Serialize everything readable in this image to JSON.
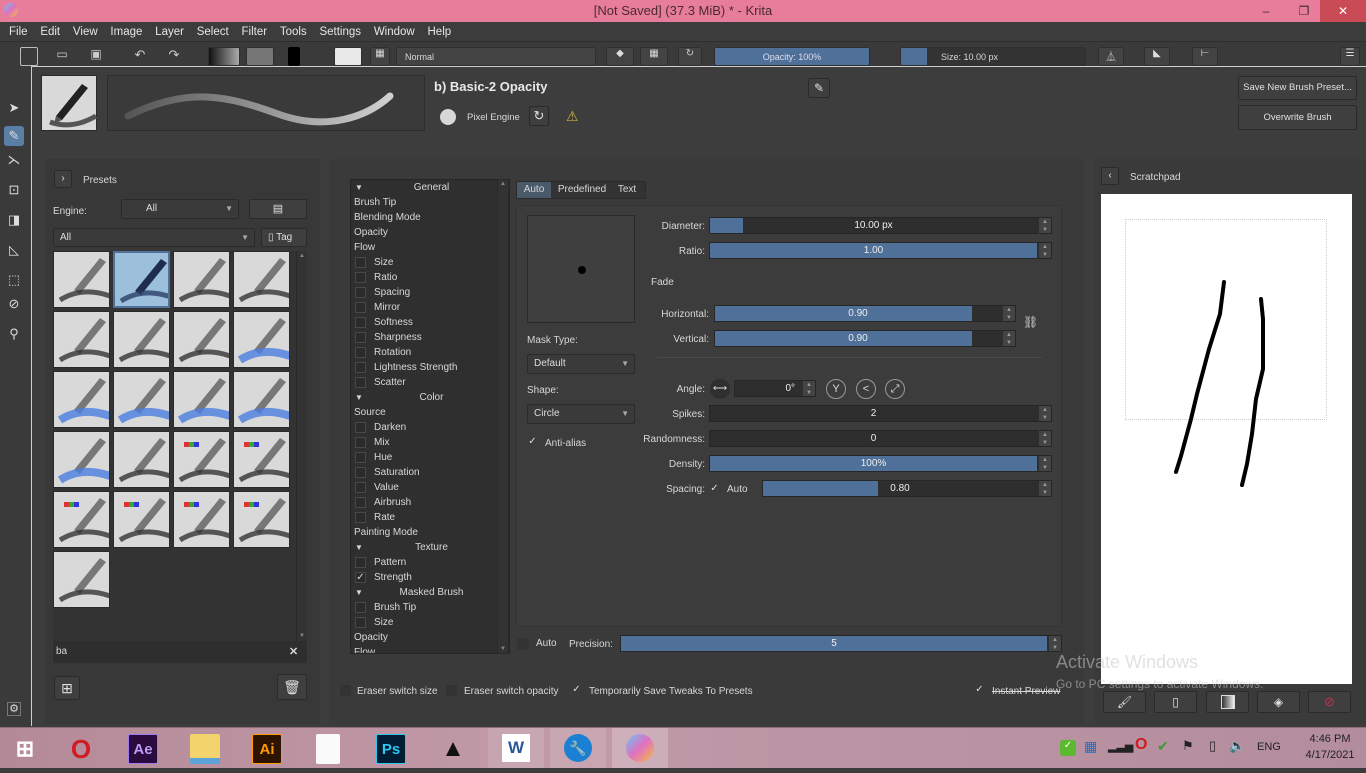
{
  "window": {
    "title": "[Not Saved]  (37.3 MiB)  * - Krita",
    "controls": {
      "minimize": "–",
      "maximize": "❐",
      "close": "✕"
    }
  },
  "menu": [
    "File",
    "Edit",
    "View",
    "Image",
    "Layer",
    "Select",
    "Filter",
    "Tools",
    "Settings",
    "Window",
    "Help"
  ],
  "toolbar": {
    "blend_mode": "Normal",
    "opacity": "Opacity: 100%",
    "size": "Size: 10.00 px"
  },
  "toolbox": {
    "tools": [
      "select-shapes",
      "freehand-brush",
      "vector-line",
      "transform",
      "gradient",
      "measure",
      "rectangle-select",
      "color-picker",
      "zoom"
    ],
    "active": "freehand-brush"
  },
  "brush_editor": {
    "preset_name": "b) Basic-2 Opacity",
    "engine_label": "Pixel Engine",
    "save_new_label": "Save New Brush Preset...",
    "overwrite_label": "Overwrite Brush",
    "presets": {
      "title": "Presets",
      "engine_label": "Engine:",
      "engine_value": "All",
      "tag_filter": "All",
      "tag_button": "Tag",
      "search_value": "ba",
      "clear_icon": "✕",
      "thumbnails": [
        {
          "name": "pencil-dark",
          "selected": false
        },
        {
          "name": "pen-blue-basic-2-opacity",
          "selected": true
        },
        {
          "name": "pencil-white",
          "selected": false
        },
        {
          "name": "pencil-grey",
          "selected": false
        },
        {
          "name": "brush-ink-1",
          "selected": false
        },
        {
          "name": "brush-ink-2",
          "selected": false
        },
        {
          "name": "brush-ink-3",
          "selected": false
        },
        {
          "name": "watercolor-1",
          "selected": false
        },
        {
          "name": "watercolor-2",
          "selected": false
        },
        {
          "name": "watercolor-3",
          "selected": false
        },
        {
          "name": "watercolor-4",
          "selected": false
        },
        {
          "name": "watercolor-5",
          "selected": false
        },
        {
          "name": "watercolor-6",
          "selected": false
        },
        {
          "name": "airbrush-white",
          "selected": false
        },
        {
          "name": "rgb-brush-smudge-1",
          "selected": false
        },
        {
          "name": "rgb-brush-smudge-2",
          "selected": false
        },
        {
          "name": "rgb-texture-hatch",
          "selected": false
        },
        {
          "name": "rgb-bristles",
          "selected": false
        },
        {
          "name": "rgb-blob",
          "selected": false
        },
        {
          "name": "rgb-rock",
          "selected": false
        },
        {
          "name": "stamp-grass",
          "selected": false
        }
      ]
    },
    "options": [
      {
        "label": "General",
        "type": "header"
      },
      {
        "label": "Brush Tip",
        "type": "item"
      },
      {
        "label": "Blending Mode",
        "type": "item"
      },
      {
        "label": "Opacity",
        "type": "item"
      },
      {
        "label": "Flow",
        "type": "item"
      },
      {
        "label": "Size",
        "type": "sub",
        "checked": false
      },
      {
        "label": "Ratio",
        "type": "sub",
        "checked": false
      },
      {
        "label": "Spacing",
        "type": "sub",
        "checked": false
      },
      {
        "label": "Mirror",
        "type": "sub",
        "checked": false
      },
      {
        "label": "Softness",
        "type": "sub",
        "checked": false
      },
      {
        "label": "Sharpness",
        "type": "sub",
        "checked": false
      },
      {
        "label": "Rotation",
        "type": "sub",
        "checked": false
      },
      {
        "label": "Lightness Strength",
        "type": "sub",
        "checked": false
      },
      {
        "label": "Scatter",
        "type": "sub",
        "checked": false
      },
      {
        "label": "Color",
        "type": "header"
      },
      {
        "label": "Source",
        "type": "item"
      },
      {
        "label": "Darken",
        "type": "sub",
        "checked": false
      },
      {
        "label": "Mix",
        "type": "sub",
        "checked": false
      },
      {
        "label": "Hue",
        "type": "sub",
        "checked": false
      },
      {
        "label": "Saturation",
        "type": "sub",
        "checked": false
      },
      {
        "label": "Value",
        "type": "sub",
        "checked": false
      },
      {
        "label": "Airbrush",
        "type": "sub",
        "checked": false
      },
      {
        "label": "Rate",
        "type": "sub",
        "checked": false
      },
      {
        "label": "Painting Mode",
        "type": "item"
      },
      {
        "label": "Texture",
        "type": "header"
      },
      {
        "label": "Pattern",
        "type": "sub",
        "checked": false
      },
      {
        "label": "Strength",
        "type": "sub",
        "checked": true
      },
      {
        "label": "Masked Brush",
        "type": "header"
      },
      {
        "label": "Brush Tip",
        "type": "sub",
        "checked": false
      },
      {
        "label": "Size",
        "type": "sub",
        "checked": false
      },
      {
        "label": "Opacity",
        "type": "item"
      },
      {
        "label": "Flow",
        "type": "item"
      }
    ],
    "tip": {
      "tabs": [
        "Auto",
        "Predefined",
        "Text"
      ],
      "active_tab": "Auto",
      "diameter": {
        "label": "Diameter:",
        "value": "10.00 px",
        "fraction": 0.1
      },
      "ratio": {
        "label": "Ratio:",
        "value": "1.00",
        "fraction": 1.0
      },
      "fade_label": "Fade",
      "horizontal": {
        "label": "Horizontal:",
        "value": "0.90",
        "fraction": 0.9
      },
      "vertical": {
        "label": "Vertical:",
        "value": "0.90",
        "fraction": 0.9
      },
      "mask_type_label": "Mask Type:",
      "mask_type_value": "Default",
      "shape_label": "Shape:",
      "shape_value": "Circle",
      "antialias_label": "Anti-alias",
      "antialias_checked": true,
      "angle": {
        "label": "Angle:",
        "value": "0°"
      },
      "spikes": {
        "label": "Spikes:",
        "value": "2",
        "fraction": 0
      },
      "randomness": {
        "label": "Randomness:",
        "value": "0",
        "fraction": 0
      },
      "density": {
        "label": "Density:",
        "value": "100%",
        "fraction": 1.0
      },
      "spacing": {
        "label": "Spacing:",
        "auto_label": "Auto",
        "auto_checked": true,
        "value": "0.80",
        "fraction": 0.42
      },
      "precision": {
        "auto_label": "Auto",
        "auto_checked": false,
        "label": "Precision:",
        "value": "5",
        "fraction": 1.0
      }
    },
    "footer": {
      "eraser_size": {
        "label": "Eraser switch size",
        "checked": false
      },
      "eraser_opacity": {
        "label": "Eraser switch opacity",
        "checked": false
      },
      "save_tweaks": {
        "label": "Temporarily Save Tweaks To Presets",
        "checked": true
      },
      "instant_preview": {
        "label": "Instant Preview",
        "checked": true
      }
    },
    "scratchpad": {
      "title": "Scratchpad",
      "buttons": [
        "paint-current-brush",
        "clear-scratchpad",
        "fill-gradient",
        "fill-background",
        "reset"
      ]
    }
  },
  "watermark": {
    "line1": "Activate Windows",
    "line2": "Go to PC settings to activate Windows."
  },
  "taskbar": {
    "apps": [
      {
        "name": "windows-start",
        "label": ""
      },
      {
        "name": "opera",
        "label": "O"
      },
      {
        "name": "after-effects",
        "label": "Ae"
      },
      {
        "name": "file-explorer",
        "label": ""
      },
      {
        "name": "illustrator",
        "label": "Ai"
      },
      {
        "name": "blank-document",
        "label": ""
      },
      {
        "name": "photoshop",
        "label": "Ps"
      },
      {
        "name": "inkscape",
        "label": ""
      },
      {
        "name": "word",
        "label": "W"
      },
      {
        "name": "settings-tool",
        "label": ""
      },
      {
        "name": "krita",
        "label": ""
      }
    ],
    "language": "ENG",
    "time": "4:46 PM",
    "date": "4/17/2021"
  },
  "colors": {
    "titlebar": "#e77d9a",
    "accent": "#4f7199",
    "close": "#c84b55"
  }
}
